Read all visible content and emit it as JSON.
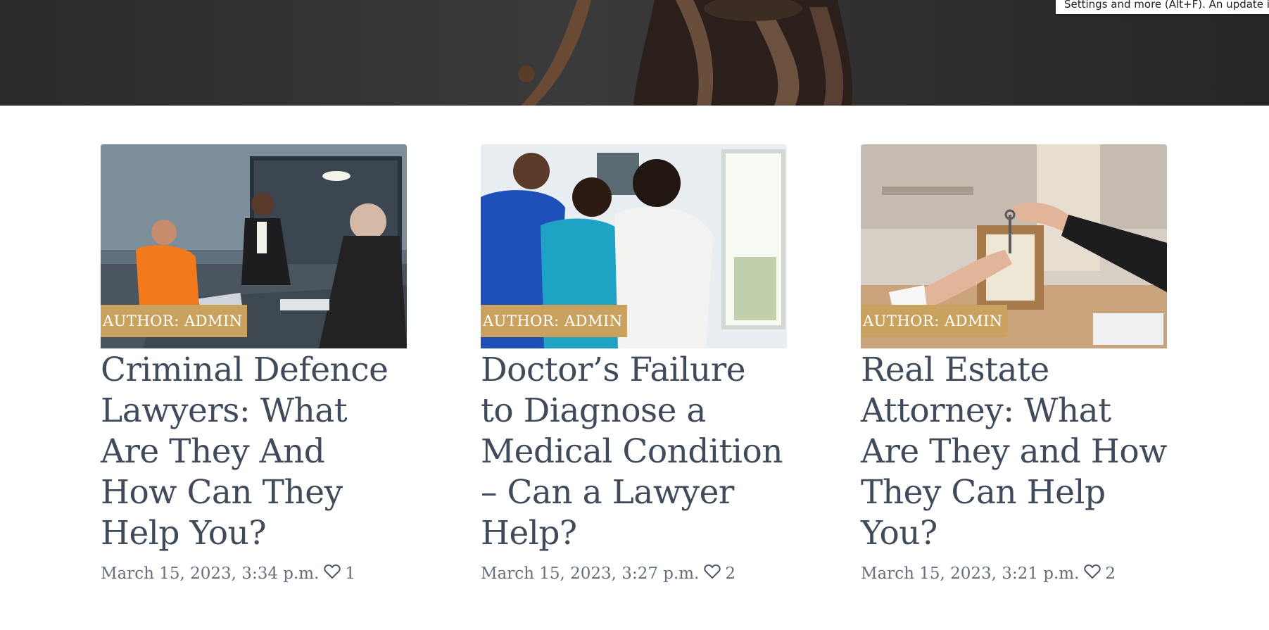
{
  "browser": {
    "tooltip_text": "Settings and more (Alt+F). An update is available."
  },
  "hero": {
    "image": "lady-justice-statue"
  },
  "posts": [
    {
      "image": "criminal-defence-interrogation-room",
      "author_badge": "AUTHOR: ADMIN",
      "title": "Criminal Defence Lawyers: What Are They And How Can They Help You?",
      "date": "March 15, 2023, 3:34 p.m.",
      "likes": "1"
    },
    {
      "image": "doctors-reviewing-xray",
      "author_badge": "AUTHOR: ADMIN",
      "title": "Doctor’s Failure to Diagnose a Medical Condition – Can a Lawyer Help?",
      "date": "March 15, 2023, 3:27 p.m.",
      "likes": "2"
    },
    {
      "image": "real-estate-key-handover",
      "author_badge": "AUTHOR: ADMIN",
      "title": "Real Estate Attorney: What Are They and How They Can Help You?",
      "date": "March 15, 2023, 3:21 p.m.",
      "likes": "2"
    }
  ],
  "colors": {
    "badge_bg": "#c9a260",
    "title_text": "#3f4a5a",
    "meta_text": "#666f7d"
  },
  "icons": {
    "like": "heart-icon"
  }
}
